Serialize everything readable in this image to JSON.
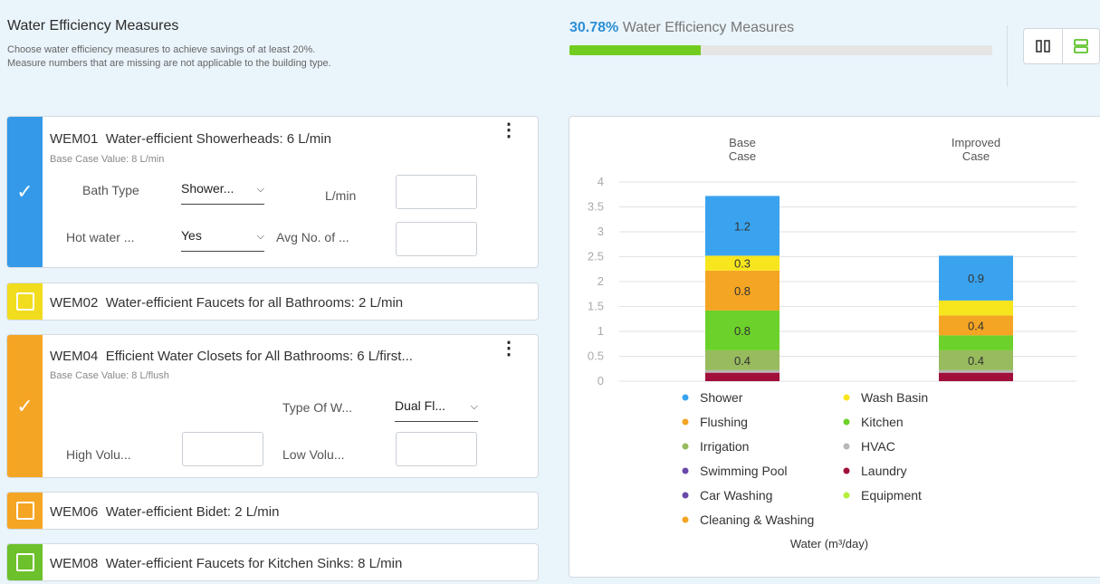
{
  "header": {
    "title": "Water Efficiency Measures",
    "subtitle_line1": "Choose water efficiency measures to achieve savings of at least 20%.",
    "subtitle_line2": "Measure numbers that are missing are not applicable to the building type."
  },
  "progress": {
    "percent_text": "30.78%",
    "label": "Water Efficiency Measures",
    "fill_fraction": 0.31
  },
  "view_toggle": {
    "options": [
      "columns-view-icon",
      "rows-view-icon"
    ],
    "selected": "rows-view-icon"
  },
  "measures": [
    {
      "code": "WEM01",
      "title": "Water-efficient Showerheads: 6 L/min",
      "selected": true,
      "color": "#3399e8",
      "base_case": "Base Case Value: 8 L/min",
      "fields": {
        "bath_type_label": "Bath Type",
        "bath_type_value": "Shower...",
        "lmin_label": "L/min",
        "hot_water_label": "Hot water ...",
        "hot_water_value": "Yes",
        "avg_no_label": "Avg No. of ..."
      }
    },
    {
      "code": "WEM02",
      "title": "Water-efficient Faucets for all Bathrooms: 2 L/min",
      "selected": false,
      "color": "#f2dc1e"
    },
    {
      "code": "WEM04",
      "title": "Efficient Water Closets for All Bathrooms: 6 L/first...",
      "selected": true,
      "color": "#f5a524",
      "base_case": "Base Case Value: 8 L/flush",
      "fields": {
        "type_label": "Type Of W...",
        "type_value": "Dual Fl...",
        "high_label": "High Volu...",
        "low_label": "Low Volu..."
      }
    },
    {
      "code": "WEM06",
      "title": "Water-efficient Bidet: 2 L/min",
      "selected": false,
      "color": "#f5a524"
    },
    {
      "code": "WEM08",
      "title": "Water-efficient Faucets for Kitchen Sinks: 8 L/min",
      "selected": false,
      "color": "#6cc12c"
    }
  ],
  "chart_data": {
    "type": "bar",
    "stacked": true,
    "categories": [
      "Base Case",
      "Improved Case"
    ],
    "category_lines": [
      [
        "Base",
        "Case"
      ],
      [
        "Improved",
        "Case"
      ]
    ],
    "xlabel": "Water (m³/day)",
    "ylim": [
      0,
      4
    ],
    "yticks": [
      0,
      0.5,
      1,
      1.5,
      2,
      2.5,
      3,
      3.5,
      4
    ],
    "ytick_labels": [
      "0",
      "0.5",
      "1",
      "1.5",
      "2",
      "2.5",
      "3",
      "3.5",
      "4"
    ],
    "grid": true,
    "legend_position": "bottom",
    "series": [
      {
        "name": "Laundry",
        "color": "#a0103a",
        "values": [
          0.17,
          0.17
        ],
        "labels": [
          "",
          ""
        ]
      },
      {
        "name": "HVAC",
        "color": "#b8b8b8",
        "values": [
          0.05,
          0.05
        ],
        "labels": [
          "",
          ""
        ]
      },
      {
        "name": "Irrigation",
        "color": "#98bb5e",
        "values": [
          0.4,
          0.4
        ],
        "labels": [
          "0.4",
          "0.4"
        ]
      },
      {
        "name": "Kitchen",
        "color": "#6cd12a",
        "values": [
          0.8,
          0.3
        ],
        "labels": [
          "0.8",
          ""
        ]
      },
      {
        "name": "Flushing",
        "color": "#f5a524",
        "values": [
          0.8,
          0.4
        ],
        "labels": [
          "0.8",
          "0.4"
        ]
      },
      {
        "name": "Wash Basin",
        "color": "#f7e51e",
        "values": [
          0.3,
          0.3
        ],
        "labels": [
          "0.3",
          ""
        ]
      },
      {
        "name": "Shower",
        "color": "#3aa3ef",
        "values": [
          1.2,
          0.9
        ],
        "labels": [
          "1.2",
          "0.9"
        ]
      }
    ],
    "legend": [
      {
        "name": "Shower",
        "color": "#3aa3ef"
      },
      {
        "name": "Wash Basin",
        "color": "#f7e51e"
      },
      {
        "name": "Flushing",
        "color": "#f5a524"
      },
      {
        "name": "Kitchen",
        "color": "#6cd12a"
      },
      {
        "name": "Irrigation",
        "color": "#98bb5e"
      },
      {
        "name": "HVAC",
        "color": "#b8b8b8"
      },
      {
        "name": "Swimming Pool",
        "color": "#6a4aa8"
      },
      {
        "name": "Laundry",
        "color": "#a0103a"
      },
      {
        "name": "Car Washing",
        "color": "#6a4aa8"
      },
      {
        "name": "Equipment",
        "color": "#b5ef3a"
      },
      {
        "name": "Cleaning & Washing",
        "color": "#f5a524"
      }
    ]
  }
}
